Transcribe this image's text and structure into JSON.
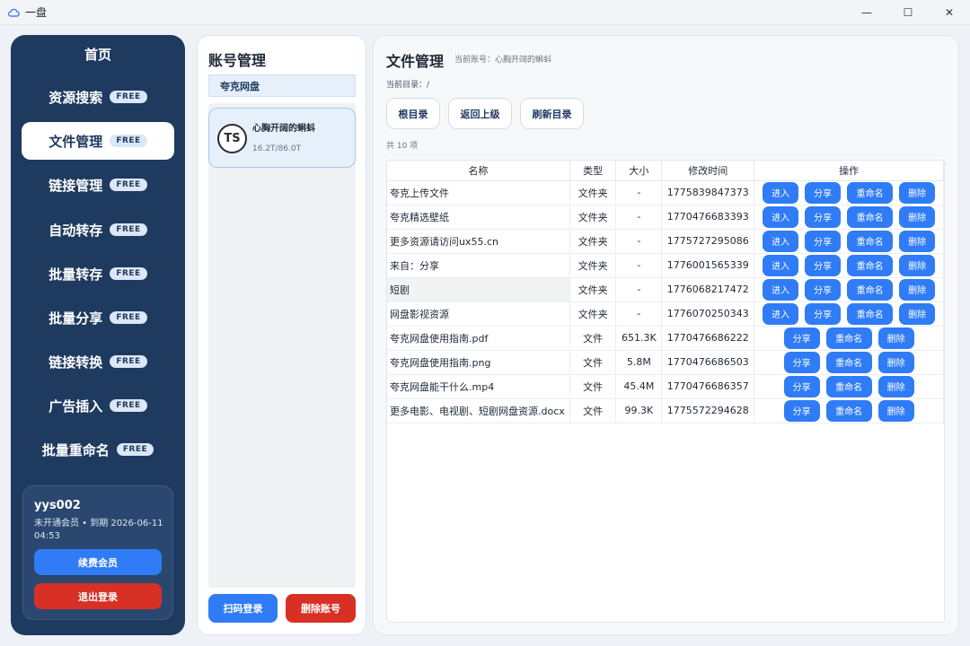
{
  "window": {
    "title": "一盘",
    "minimize": "—",
    "maximize": "☐",
    "close": "✕"
  },
  "sidebar": {
    "items": [
      {
        "label": "首页",
        "badge": ""
      },
      {
        "label": "资源搜索",
        "badge": "FREE"
      },
      {
        "label": "文件管理",
        "badge": "FREE"
      },
      {
        "label": "链接管理",
        "badge": "FREE"
      },
      {
        "label": "自动转存",
        "badge": "FREE"
      },
      {
        "label": "批量转存",
        "badge": "FREE"
      },
      {
        "label": "批量分享",
        "badge": "FREE"
      },
      {
        "label": "链接转换",
        "badge": "FREE"
      },
      {
        "label": "广告插入",
        "badge": "FREE"
      },
      {
        "label": "批量重命名",
        "badge": "FREE"
      }
    ],
    "active_index": 2,
    "user": {
      "name": "yys002",
      "status": "未开通会员 • 到期 2026-06-11 04:53",
      "renew_label": "续费会员",
      "logout_label": "退出登录"
    }
  },
  "accounts": {
    "title": "账号管理",
    "tab": "夸克网盘",
    "card": {
      "avatar_text": "TS",
      "name": "心胸开阔的蝌蚪",
      "quota": "16.2T/86.0T"
    },
    "scan_label": "扫码登录",
    "delete_label": "删除账号"
  },
  "files": {
    "title": "文件管理",
    "current_account": "当前账号：心胸开阔的蝌蚪",
    "current_dir": "当前目录：/",
    "toolbar": {
      "root": "根目录",
      "up": "返回上级",
      "refresh": "刷新目录"
    },
    "count": "共 10 项",
    "columns": [
      "名称",
      "类型",
      "大小",
      "修改时间",
      "操作"
    ],
    "op_labels": {
      "enter": "进入",
      "share": "分享",
      "rename": "重命名",
      "delete": "删除"
    },
    "rows": [
      {
        "name": "夸克上传文件",
        "type": "文件夹",
        "size": "-",
        "mtime": "1775839847373",
        "folder": true
      },
      {
        "name": "夸克精选壁纸",
        "type": "文件夹",
        "size": "-",
        "mtime": "1770476683393",
        "folder": true
      },
      {
        "name": "更多资源请访问ux55.cn",
        "type": "文件夹",
        "size": "-",
        "mtime": "1775727295086",
        "folder": true
      },
      {
        "name": "来自：分享",
        "type": "文件夹",
        "size": "-",
        "mtime": "1776001565339",
        "folder": true
      },
      {
        "name": "短剧",
        "type": "文件夹",
        "size": "-",
        "mtime": "1776068217472",
        "folder": true
      },
      {
        "name": "网盘影视资源",
        "type": "文件夹",
        "size": "-",
        "mtime": "1776070250343",
        "folder": true
      },
      {
        "name": "夸克网盘使用指南.pdf",
        "type": "文件",
        "size": "651.3K",
        "mtime": "1770476686222",
        "folder": false
      },
      {
        "name": "夸克网盘使用指南.png",
        "type": "文件",
        "size": "5.8M",
        "mtime": "1770476686503",
        "folder": false
      },
      {
        "name": "夸克网盘能干什么.mp4",
        "type": "文件",
        "size": "45.4M",
        "mtime": "1770476686357",
        "folder": false
      },
      {
        "name": "更多电影、电视剧、短剧网盘资源.docx",
        "type": "文件",
        "size": "99.3K",
        "mtime": "1775572294628",
        "folder": false
      }
    ],
    "highlighted_row": 4
  }
}
